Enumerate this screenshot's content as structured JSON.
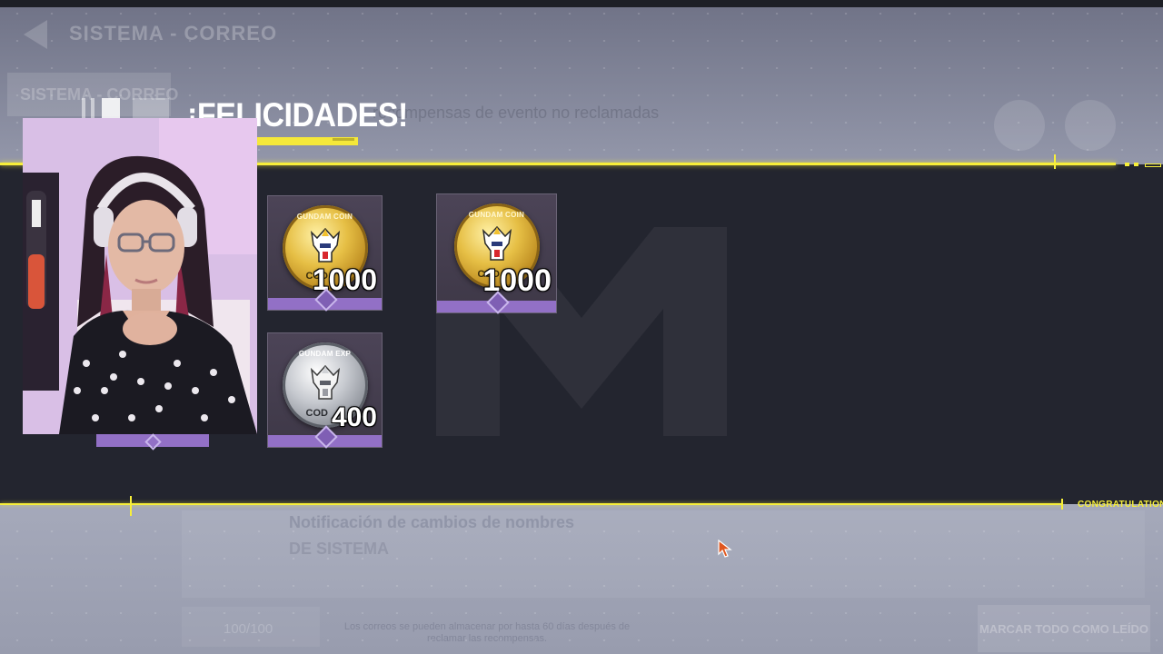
{
  "background": {
    "header_title": "SISTEMA - CORREO",
    "tab_label": "SISTEMA - CORREO",
    "subtitle": "recompensas de evento no reclamadas",
    "notification_title": "Notificación de cambios de nombres",
    "notification_sub": "DE SISTEMA",
    "mail_count": "100/100",
    "footnote": "Los correos se pueden almacenar por hasta 60 días después de reclamar las recompensas.",
    "mark_all_button": "MARCAR TODO COMO LEÍDO"
  },
  "popup": {
    "title": "¡FELICIDADES!",
    "banner_label": "CONGRATULATIONS",
    "rewards": [
      {
        "name": "Gundam Coin",
        "ring_text": "GUNDAM COIN",
        "mark": "COD",
        "amount": "1000",
        "coin": "gold"
      },
      {
        "name": "Gundam Coin",
        "ring_text": "GUNDAM COIN",
        "mark": "COD",
        "amount": "1000",
        "coin": "gold"
      },
      {
        "name": "Gundam EXP",
        "ring_text": "GUNDAM EXP",
        "mark": "COD",
        "amount": "400",
        "coin": "silver"
      }
    ]
  },
  "colors": {
    "accent_yellow": "#f7ef3a",
    "rarity_purple": "#9270c6",
    "band": "#23252f"
  }
}
